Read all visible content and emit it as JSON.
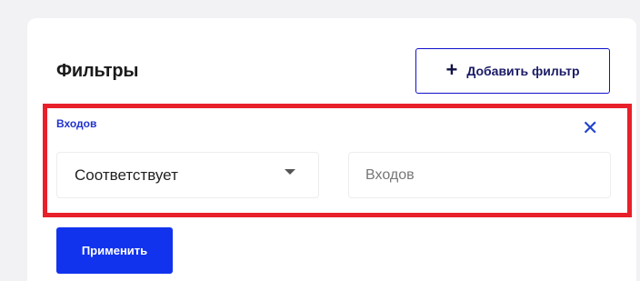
{
  "panel": {
    "title": "Фильтры",
    "add_filter_label": "Добавить фильтр",
    "add_icon": "plus-icon"
  },
  "filter": {
    "field_label": "Входов",
    "close_icon": "close-icon",
    "operator": {
      "selected": "Соответствует",
      "icon": "chevron-down-icon"
    },
    "value_input": {
      "value": "",
      "placeholder": "Входов"
    }
  },
  "apply_label": "Применить",
  "colors": {
    "accent": "#1133ee",
    "highlight": "#e8202a",
    "label": "#2233cc"
  }
}
